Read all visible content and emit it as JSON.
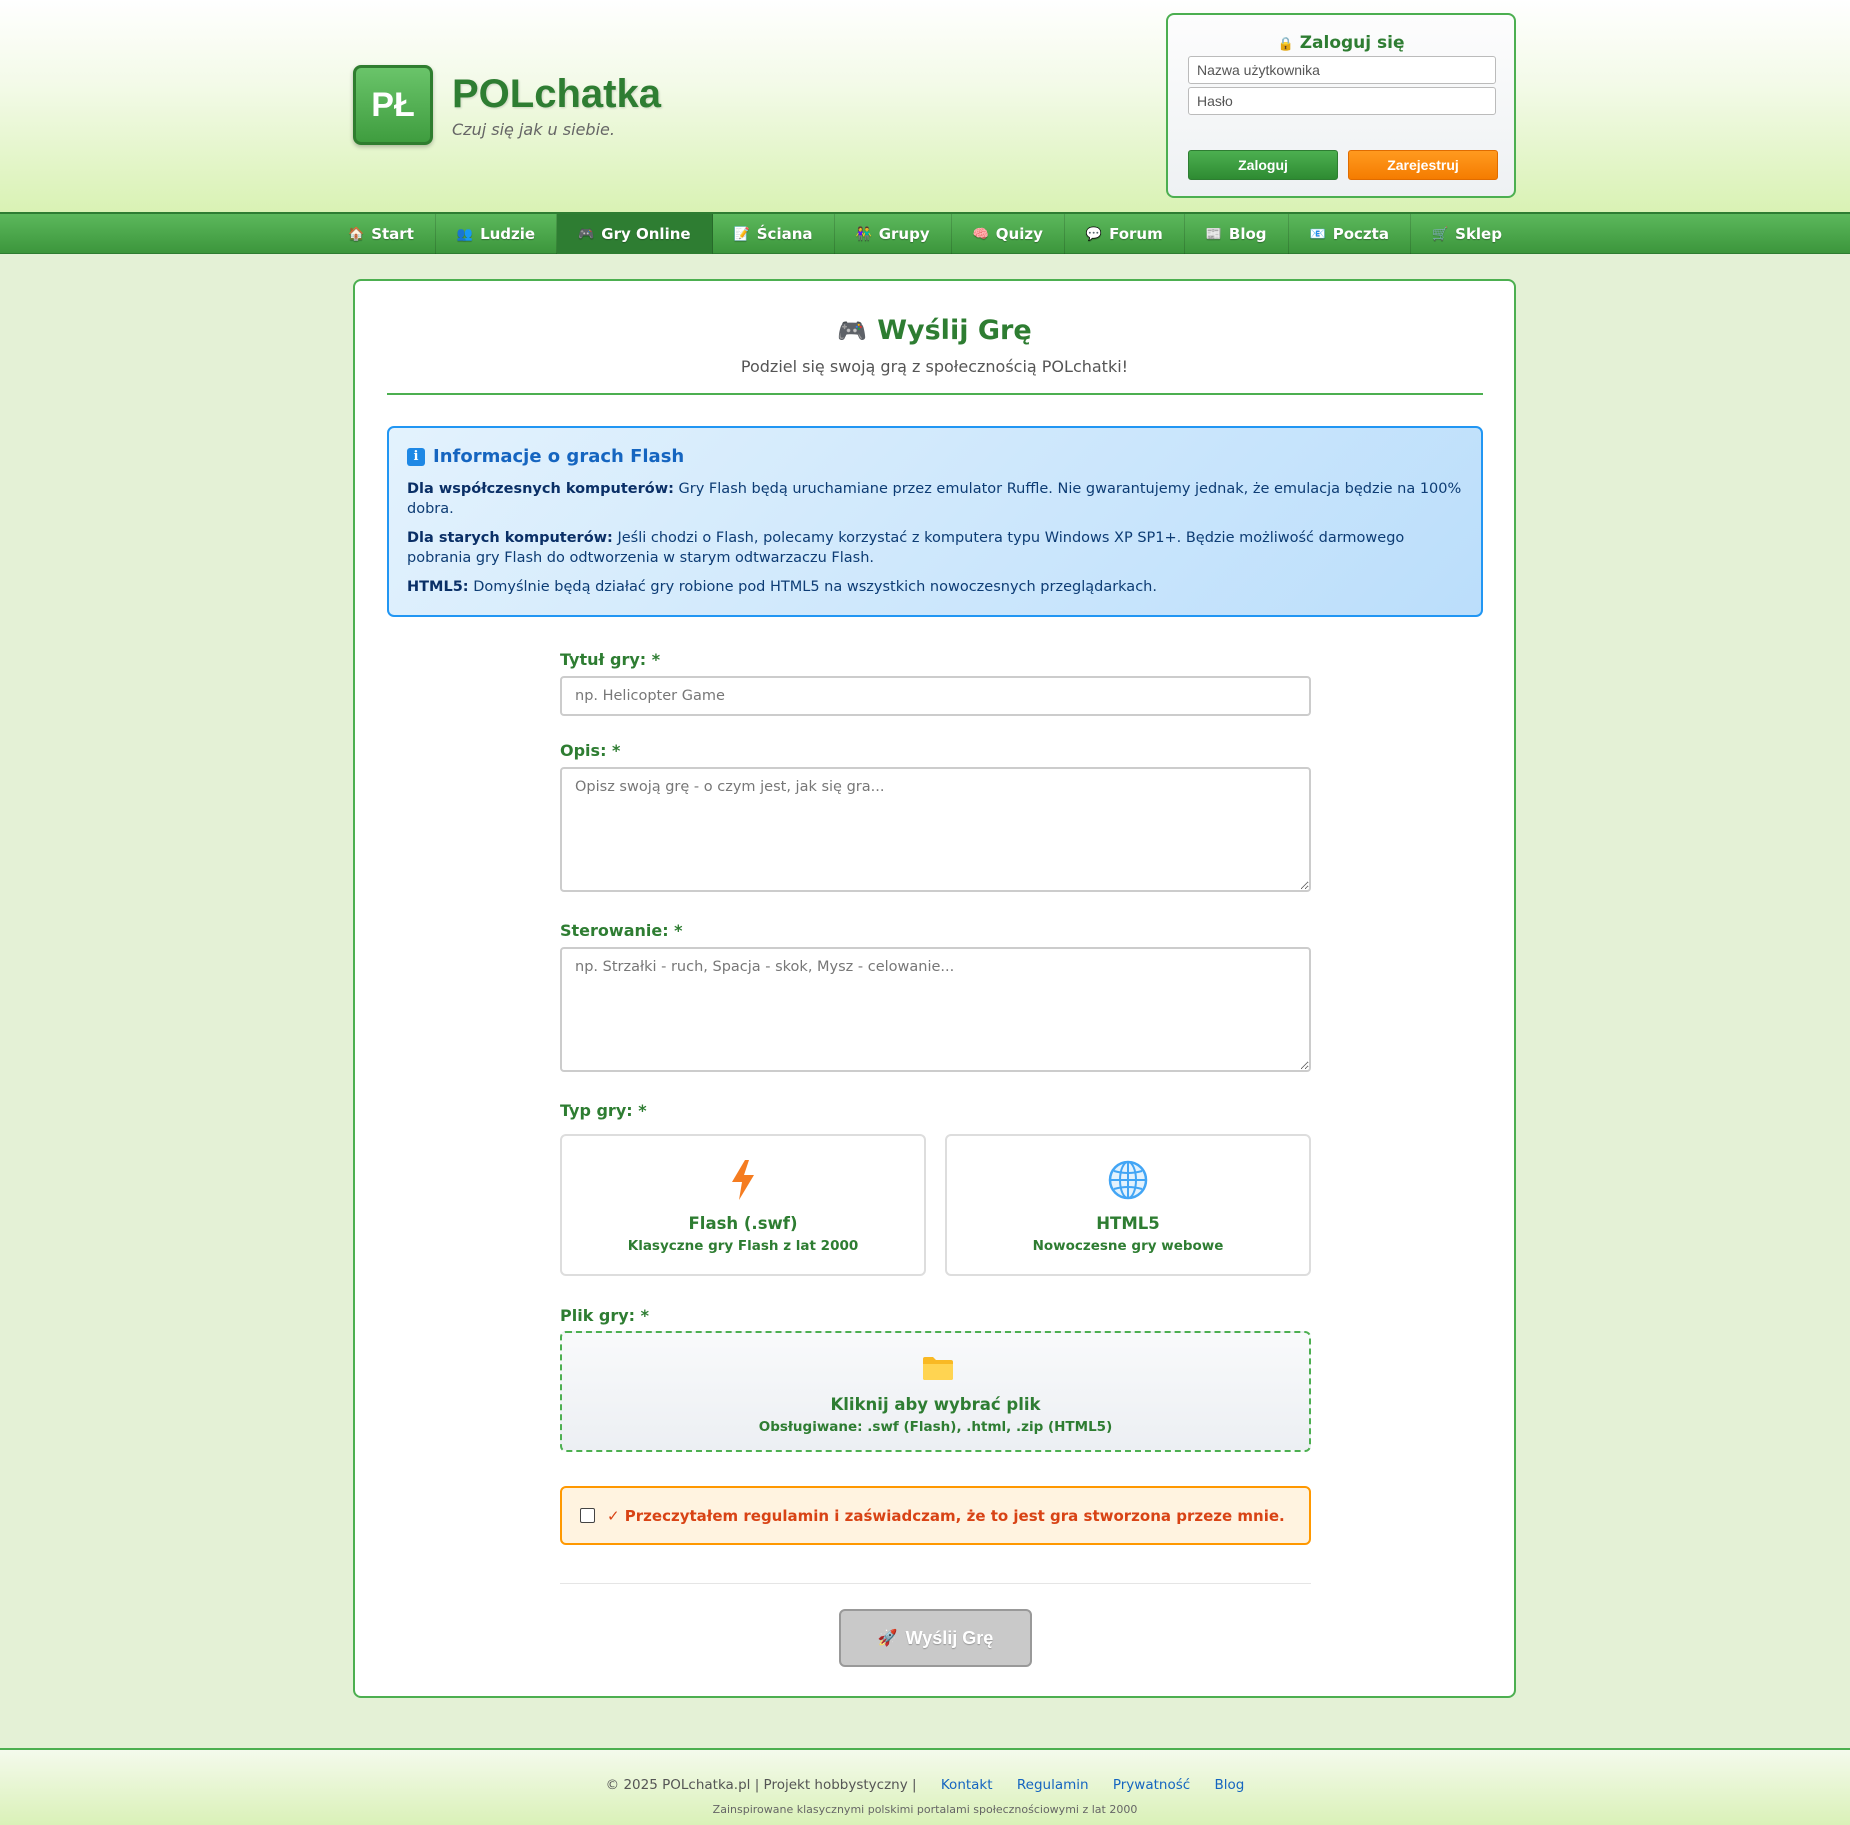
{
  "header": {
    "logo_text": "PŁ",
    "site_name": "POLchatka",
    "slogan": "Czuj się jak u siebie."
  },
  "login": {
    "title_icon": "🔒",
    "title": "Zaloguj się",
    "username_placeholder": "Nazwa użytkownika",
    "password_placeholder": "Hasło",
    "login_button": "Zaloguj",
    "register_button": "Zarejestruj"
  },
  "nav": {
    "items": [
      {
        "icon": "🏠",
        "label": "Start"
      },
      {
        "icon": "👥",
        "label": "Ludzie"
      },
      {
        "icon": "🎮",
        "label": "Gry Online"
      },
      {
        "icon": "📝",
        "label": "Ściana"
      },
      {
        "icon": "👫",
        "label": "Grupy"
      },
      {
        "icon": "🧠",
        "label": "Quizy"
      },
      {
        "icon": "💬",
        "label": "Forum"
      },
      {
        "icon": "📰",
        "label": "Blog"
      },
      {
        "icon": "📧",
        "label": "Poczta"
      },
      {
        "icon": "🛒",
        "label": "Sklep"
      }
    ],
    "active": "Gry Online"
  },
  "page": {
    "title_icon": "🎮",
    "title": "Wyślij Grę",
    "subtitle": "Podziel się swoją grą z społecznością POLchatki!"
  },
  "info": {
    "icon": "i",
    "title": "Informacje o grach Flash",
    "p1_label": "Dla współczesnych komputerów:",
    "p1_text": " Gry Flash będą uruchamiane przez emulator Ruffle. Nie gwarantujemy jednak, że emulacja będzie na 100% dobra.",
    "p2_label": "Dla starych komputerów:",
    "p2_text": " Jeśli chodzi o Flash, polecamy korzystać z komputera typu Windows XP SP1+. Będzie możliwość darmowego pobrania gry Flash do odtworzenia w starym odtwarzaczu Flash.",
    "p3_label": "HTML5:",
    "p3_text": " Domyślnie będą działać gry robione pod HTML5 na wszystkich nowoczesnych przeglądarkach."
  },
  "form": {
    "title_label": "Tytuł gry: *",
    "title_placeholder": "np. Helicopter Game",
    "desc_label": "Opis: *",
    "desc_placeholder": "Opisz swoją grę - o czym jest, jak się gra...",
    "controls_label": "Sterowanie: *",
    "controls_placeholder": "np. Strzałki - ruch, Spacja - skok, Mysz - celowanie...",
    "type_label": "Typ gry: *",
    "types": [
      {
        "icon": "lightning-icon",
        "name": "Flash (.swf)",
        "desc": "Klasyczne gry Flash z lat 2000"
      },
      {
        "icon": "globe-icon",
        "name": "HTML5",
        "desc": "Nowoczesne gry webowe"
      }
    ],
    "file_label": "Plik gry: *",
    "file_main": "Kliknij aby wybrać plik",
    "file_sub": "Obsługiwane: .swf (Flash), .html, .zip (HTML5)",
    "agree_text": "✓ Przeczytałem regulamin i zaświadczam, że to jest gra stworzona przeze mnie.",
    "agree_checked": false,
    "submit_icon": "🚀",
    "submit_label": "Wyślij Grę"
  },
  "footer": {
    "copyright": "© 2025 POLchatka.pl | Projekt hobbystyczny |",
    "links": [
      "Kontakt",
      "Regulamin",
      "Prywatność",
      "Blog"
    ],
    "sub": "Zainspirowane klasycznymi polskimi portalami społecznościowymi z lat 2000"
  },
  "colors": {
    "brand_green": "#2e7d32",
    "accent_green": "#4caf50",
    "register_orange": "#f57c00",
    "info_blue": "#2196f3",
    "warning_orange": "#ff9800"
  }
}
